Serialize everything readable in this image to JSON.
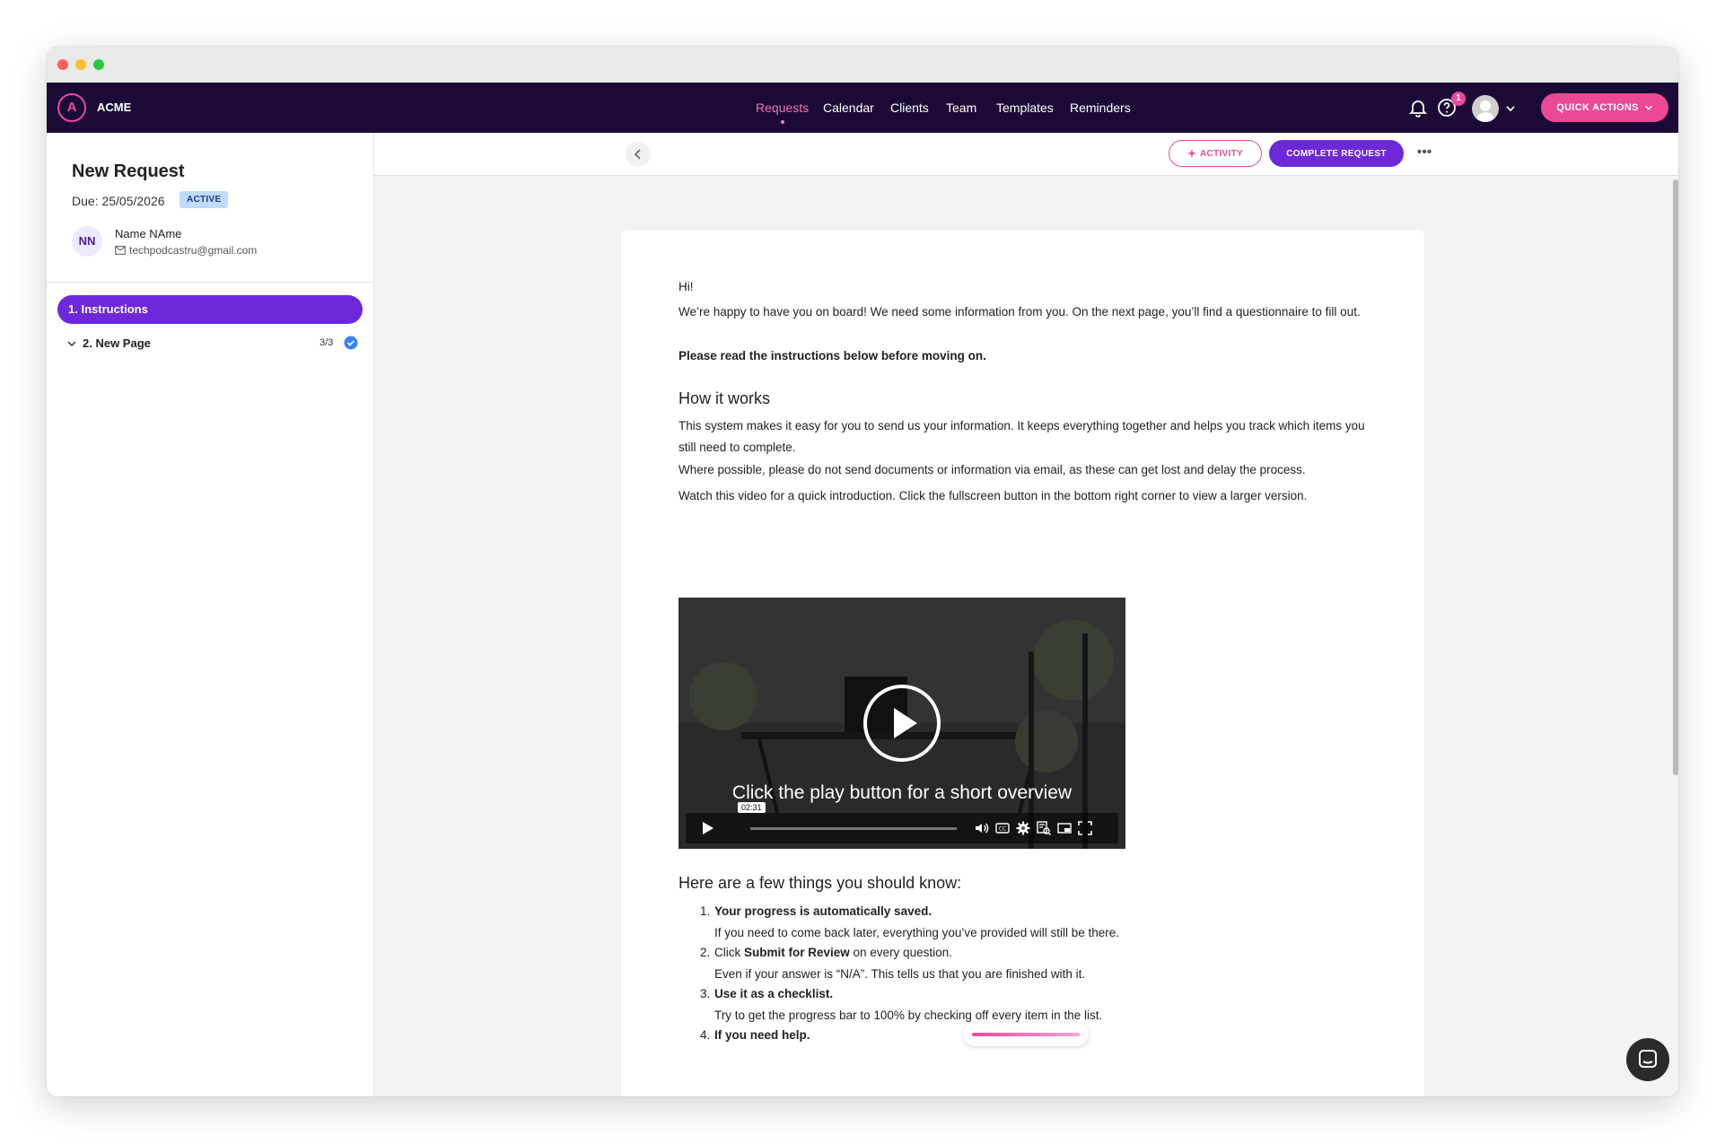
{
  "app": {
    "brand": "ACME"
  },
  "nav": {
    "items": [
      "Requests",
      "Calendar",
      "Clients",
      "Team",
      "Templates",
      "Reminders"
    ],
    "active": "Requests",
    "help_badge": "1",
    "quick_actions": "QUICK ACTIONS"
  },
  "sidebar": {
    "title": "New Request",
    "due": "Due: 25/05/2026",
    "status": "ACTIVE",
    "client_initials": "NN",
    "client_name": "Name NAme",
    "client_email": "techpodcastru@gmail.com",
    "steps": [
      {
        "label": "1. Instructions"
      },
      {
        "label": "2. New Page",
        "count": "3/3"
      }
    ]
  },
  "toolbar": {
    "activity": "ACTIVITY",
    "complete": "COMPLETE REQUEST"
  },
  "content": {
    "greeting": "Hi!",
    "intro": "We’re happy to have you on board! We need some information from you. On the next page, you’ll find a questionnaire to fill out.",
    "read_note": "Please read the instructions below before moving on.",
    "how_title": "How it works",
    "how_p1": "This system makes it easy for you to send us your information. It keeps everything together and helps you track which items you still need to complete.",
    "how_p2": "Where possible, please do not send documents or information via email, as these can get lost and delay the process.",
    "how_p3": "Watch this video for a quick introduction. Click the fullscreen button in the bottom right corner to view a larger version.",
    "video_caption": "Click the play button for a short overview",
    "video_time": "02:31",
    "know_title": "Here are a few things you should know:",
    "list": [
      {
        "num": "1.",
        "title": "Your progress is automatically saved.",
        "detail": "If you need to come back later, everything you’ve provided will still be there."
      },
      {
        "num": "2.",
        "pre": "Click ",
        "title": "Submit for Review",
        "post": " on every question.",
        "detail": "Even if your answer is “N/A”. This tells us that you are finished with it."
      },
      {
        "num": "3.",
        "title": "Use it as a checklist.",
        "detail": "Try to get the progress bar to 100% by checking off every item in the list."
      },
      {
        "num": "4.",
        "title": "If you need help."
      }
    ]
  },
  "colors": {
    "navbar": "#1c0a36",
    "accent_pink": "#ec4899",
    "accent_purple": "#6d28d9"
  }
}
